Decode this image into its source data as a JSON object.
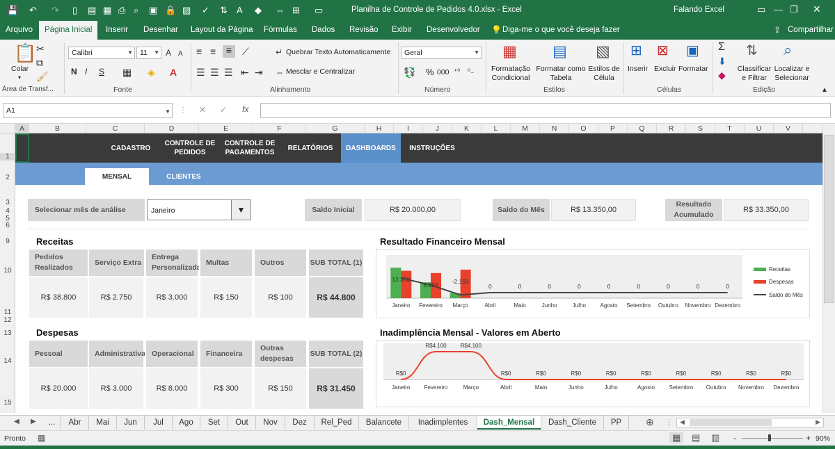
{
  "app": {
    "window_title": "Planilha de Controle de Pedidos 4.0.xlsx  -  Excel",
    "user": "Falando Excel",
    "share_label": "Compartilhar",
    "tell_me_placeholder": "Diga-me o que você deseja fazer"
  },
  "ribbon_tabs": [
    "Arquivo",
    "Página Inicial",
    "Inserir",
    "Desenhar",
    "Layout da Página",
    "Fórmulas",
    "Dados",
    "Revisão",
    "Exibir",
    "Desenvolvedor"
  ],
  "ribbon": {
    "clipboard": {
      "paste": "Colar",
      "label": "Área de Transf..."
    },
    "font": {
      "name": "Calibri",
      "size": "11",
      "bold": "N",
      "italic": "I",
      "underline": "S",
      "label": "Fonte"
    },
    "alignment": {
      "wrap": "Quebrar Texto Automaticamente",
      "merge": "Mesclar e Centralizar",
      "label": "Alinhamento"
    },
    "number": {
      "format": "Geral",
      "percent": "%",
      "thousands": "000",
      "label": "Número"
    },
    "styles": {
      "conditional": "Formatação Condicional",
      "format_table": "Formatar como Tabela",
      "cell_styles": "Estilos de Célula",
      "label": "Estilos"
    },
    "cells": {
      "insert": "Inserir",
      "delete": "Excluir",
      "format": "Formatar",
      "label": "Células"
    },
    "editing": {
      "sort": "Classificar e Filtrar",
      "find": "Localizar e Selecionar",
      "label": "Edição"
    }
  },
  "formula_bar": {
    "name_box": "A1",
    "cancel": "✕",
    "enter": "✓",
    "fx": "fx",
    "value": ""
  },
  "columns": [
    "A",
    "B",
    "C",
    "D",
    "E",
    "F",
    "G",
    "H",
    "I",
    "J",
    "K",
    "L",
    "M",
    "N",
    "O",
    "P",
    "Q",
    "R",
    "S",
    "T",
    "U",
    "V"
  ],
  "rows": [
    "1",
    "2",
    "3",
    "4",
    "5",
    "6",
    "9",
    "10",
    "11",
    "12",
    "13",
    "14",
    "15"
  ],
  "dashboard": {
    "nav": [
      "CADASTRO",
      "CONTROLE DE PEDIDOS",
      "CONTROLE DE PAGAMENTOS",
      "RELATÓRIOS",
      "DASHBOARDS",
      "INSTRUÇÕES"
    ],
    "subtabs": [
      "MENSAL",
      "CLIENTES"
    ],
    "select_label": "Selecionar mês de análise",
    "month_value": "Janeiro",
    "saldo_inicial_label": "Saldo Inicial",
    "saldo_inicial_value": "R$ 20.000,00",
    "saldo_mes_label": "Saldo do Mês",
    "saldo_mes_value": "R$ 13.350,00",
    "resultado_label": "Resultado Acumulado",
    "resultado_value": "R$ 33.350,00",
    "receitas": {
      "title": "Receitas",
      "headers": [
        "Pedidos Realizados",
        "Serviço Extra",
        "Entrega Personalizada",
        "Multas",
        "Outros",
        "SUB TOTAL (1)"
      ],
      "values": [
        "R$ 38.800",
        "R$ 2.750",
        "R$ 3.000",
        "R$ 150",
        "R$ 100",
        "R$ 44.800"
      ]
    },
    "despesas": {
      "title": "Despesas",
      "headers": [
        "Pessoal",
        "Administrativa",
        "Operacional",
        "Financeira",
        "Outras despesas",
        "SUB TOTAL (2)"
      ],
      "values": [
        "R$ 20.000",
        "R$ 3.000",
        "R$ 8.000",
        "R$ 300",
        "R$ 150",
        "R$ 31.450"
      ]
    }
  },
  "chart_data": [
    {
      "type": "bar",
      "title": "Resultado Financeiro Mensal",
      "categories": [
        "Janeiro",
        "Fevereiro",
        "Março",
        "Abril",
        "Maio",
        "Junho",
        "Julho",
        "Agosto",
        "Setembro",
        "Outubro",
        "Novembro",
        "Dezembro"
      ],
      "series": [
        {
          "name": "Receitas",
          "type": "bar",
          "color": "#4CAF50",
          "values": [
            13350,
            6950,
            -2150,
            0,
            0,
            0,
            0,
            0,
            0,
            0,
            0,
            0
          ]
        },
        {
          "name": "Despesas",
          "type": "bar",
          "color": "#E8412C",
          "values": [
            12000,
            11000,
            12500,
            0,
            0,
            0,
            0,
            0,
            0,
            0,
            0,
            0
          ]
        },
        {
          "name": "Saldo do Mês",
          "type": "line",
          "color": "#444444",
          "values": [
            13350,
            6950,
            -2150,
            0,
            0,
            0,
            0,
            0,
            0,
            0,
            0,
            0
          ]
        }
      ],
      "data_labels": [
        "13.350",
        "6.950",
        "-2.150",
        "0",
        "0",
        "0",
        "0",
        "0",
        "0",
        "0",
        "0",
        "0"
      ],
      "legend": "right"
    },
    {
      "type": "line",
      "title": "Inadimplência Mensal - Valores em Aberto",
      "categories": [
        "Janeiro",
        "Fevereiro",
        "Março",
        "Abril",
        "Maio",
        "Junho",
        "Julho",
        "Agosto",
        "Setembro",
        "Outubro",
        "Novembro",
        "Dezembro"
      ],
      "series": [
        {
          "color": "#E8412C",
          "values": [
            0,
            4100,
            4100,
            0,
            0,
            0,
            0,
            0,
            0,
            0,
            0,
            0
          ]
        }
      ],
      "data_labels": [
        "R$0",
        "R$4.100",
        "R$4.100",
        "R$0",
        "R$0",
        "R$0",
        "R$0",
        "R$0",
        "R$0",
        "R$0",
        "R$0",
        "R$0"
      ]
    }
  ],
  "sheet_tabs": [
    "...",
    "Abr",
    "Mai",
    "Jun",
    "Jul",
    "Ago",
    "Set",
    "Out",
    "Nov",
    "Dez",
    "Rel_Ped",
    "Balancete",
    "Inadimplentes",
    "Dash_Mensal",
    "Dash_Cliente",
    "PP"
  ],
  "status": {
    "ready": "Pronto",
    "zoom": "90%",
    "zoom_minus": "-",
    "zoom_plus": "+"
  },
  "colors": {
    "excel_green": "#217346",
    "nav_dark": "#3a3a3a",
    "nav_active": "#5b8fc9",
    "band_blue": "#6b9bd1",
    "receitas": "#4CAF50",
    "despesas": "#E8412C"
  }
}
